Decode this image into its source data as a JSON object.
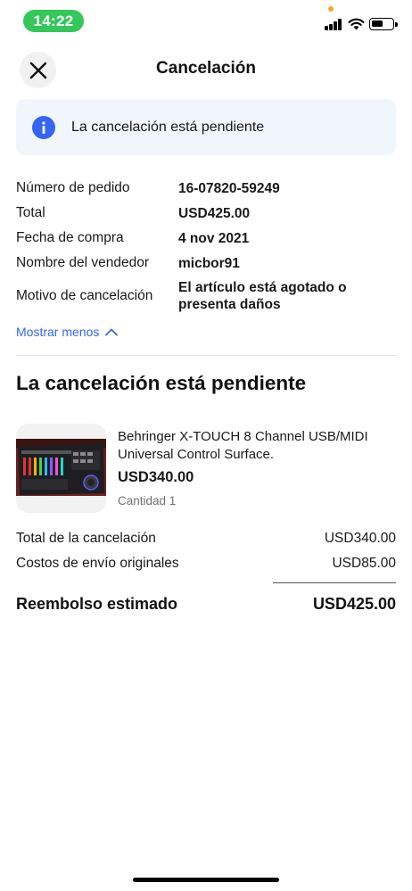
{
  "status_bar": {
    "time": "14:22"
  },
  "header": {
    "title": "Cancelación"
  },
  "banner": {
    "text": "La cancelación está pendiente"
  },
  "details": [
    {
      "label": "Número de pedido",
      "value": "16-07820-59249"
    },
    {
      "label": "Total",
      "value": "USD425.00"
    },
    {
      "label": "Fecha de compra",
      "value": "4 nov 2021"
    },
    {
      "label": "Nombre del vendedor",
      "value": "micbor91"
    },
    {
      "label": "Motivo de cancelación",
      "value": "El artículo está agotado o presenta daños"
    }
  ],
  "show_less": {
    "label": "Mostrar menos"
  },
  "section": {
    "title": "La cancelación está pendiente"
  },
  "item": {
    "title": "Behringer X-TOUCH 8 Channel USB/MIDI Universal Control Surface.",
    "price": "USD340.00",
    "quantity": "Cantidad 1"
  },
  "summary": {
    "cancel_total_label": "Total de la cancelación",
    "cancel_total_value": "USD340.00",
    "shipping_label": "Costos de envío originales",
    "shipping_value": "USD85.00",
    "refund_label": "Reembolso estimado",
    "refund_value": "USD425.00"
  },
  "colors": {
    "accent": "#3665f3",
    "status_pill": "#34c759",
    "banner_bg": "#f1f6fd"
  },
  "icons": [
    "close-icon",
    "info-icon",
    "chevron-up-icon",
    "signal-icon",
    "wifi-icon",
    "battery-icon"
  ]
}
